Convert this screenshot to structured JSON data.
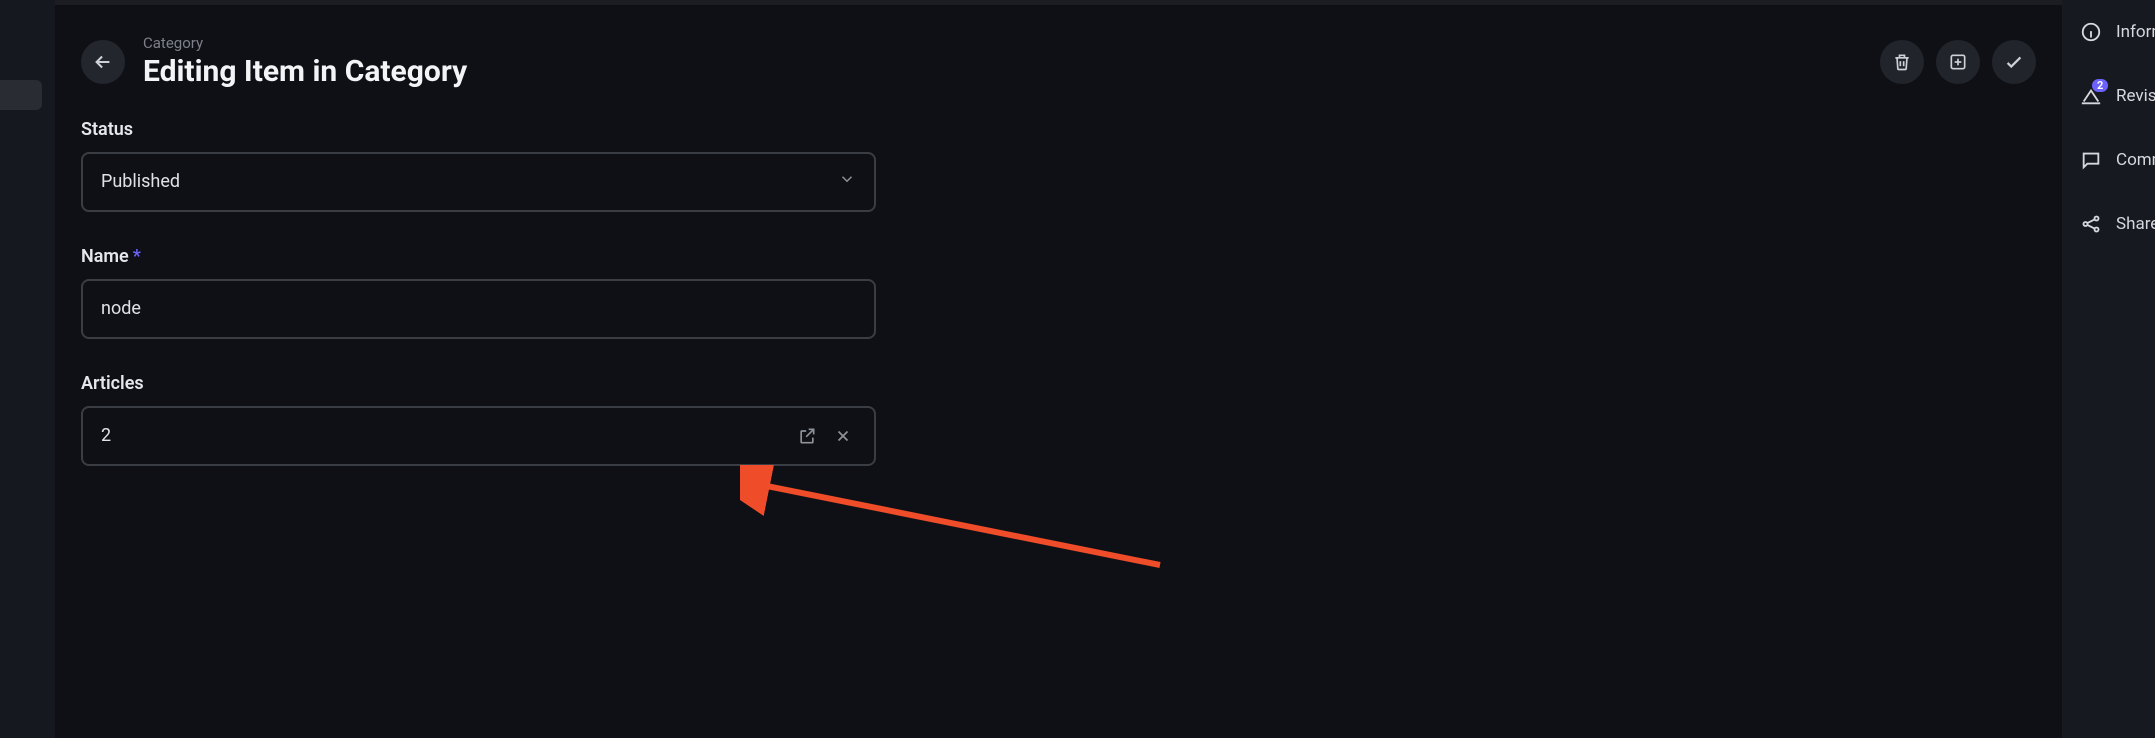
{
  "header": {
    "breadcrumb": "Category",
    "title": "Editing Item in Category"
  },
  "actions": {
    "delete_tooltip": "Delete",
    "archive_tooltip": "Archive",
    "save_tooltip": "Save"
  },
  "form": {
    "status": {
      "label": "Status",
      "value": "Published"
    },
    "name": {
      "label": "Name",
      "required": true,
      "value": "node"
    },
    "articles": {
      "label": "Articles",
      "value": "2"
    }
  },
  "right_sidebar": {
    "items": [
      {
        "id": "information",
        "label": "Information",
        "icon": "info-icon"
      },
      {
        "id": "revisions",
        "label": "Revisions",
        "icon": "revisions-icon",
        "badge": "2"
      },
      {
        "id": "comments",
        "label": "Comments",
        "icon": "comment-icon"
      },
      {
        "id": "shares",
        "label": "Shares",
        "icon": "share-icon"
      }
    ]
  },
  "colors": {
    "accent": "#6c63ff",
    "annotation_arrow": "#ef4c2a"
  }
}
